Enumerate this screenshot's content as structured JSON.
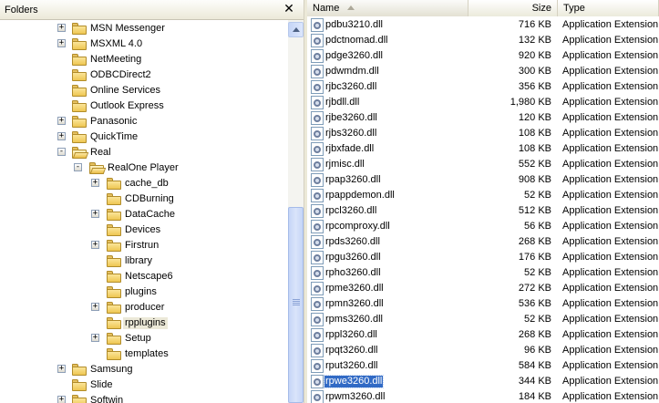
{
  "folders_pane": {
    "title": "Folders",
    "close_glyph": "✕",
    "tree": [
      {
        "label": "MSN Messenger",
        "indent": 1,
        "expander": "+"
      },
      {
        "label": "MSXML 4.0",
        "indent": 1,
        "expander": "+"
      },
      {
        "label": "NetMeeting",
        "indent": 1,
        "expander": ""
      },
      {
        "label": "ODBCDirect2",
        "indent": 1,
        "expander": ""
      },
      {
        "label": "Online Services",
        "indent": 1,
        "expander": ""
      },
      {
        "label": "Outlook Express",
        "indent": 1,
        "expander": ""
      },
      {
        "label": "Panasonic",
        "indent": 1,
        "expander": "+"
      },
      {
        "label": "QuickTime",
        "indent": 1,
        "expander": "+"
      },
      {
        "label": "Real",
        "indent": 1,
        "expander": "-",
        "open": true
      },
      {
        "label": "RealOne Player",
        "indent": 2,
        "expander": "-",
        "open": true
      },
      {
        "label": "cache_db",
        "indent": 3,
        "expander": "+"
      },
      {
        "label": "CDBurning",
        "indent": 3,
        "expander": ""
      },
      {
        "label": "DataCache",
        "indent": 3,
        "expander": "+"
      },
      {
        "label": "Devices",
        "indent": 3,
        "expander": ""
      },
      {
        "label": "Firstrun",
        "indent": 3,
        "expander": "+"
      },
      {
        "label": "library",
        "indent": 3,
        "expander": ""
      },
      {
        "label": "Netscape6",
        "indent": 3,
        "expander": ""
      },
      {
        "label": "plugins",
        "indent": 3,
        "expander": ""
      },
      {
        "label": "producer",
        "indent": 3,
        "expander": "+"
      },
      {
        "label": "rpplugins",
        "indent": 3,
        "expander": "",
        "selected": true
      },
      {
        "label": "Setup",
        "indent": 3,
        "expander": "+"
      },
      {
        "label": "templates",
        "indent": 3,
        "expander": ""
      },
      {
        "label": "Samsung",
        "indent": 1,
        "expander": "+"
      },
      {
        "label": "Slide",
        "indent": 1,
        "expander": ""
      },
      {
        "label": "Softwin",
        "indent": 1,
        "expander": "+"
      }
    ]
  },
  "file_list": {
    "columns": {
      "name": "Name",
      "size": "Size",
      "type": "Type"
    },
    "sort": {
      "column": "Name",
      "direction": "ascending"
    },
    "rows": [
      {
        "name": "pdbu3210.dll",
        "size": "716 KB",
        "type": "Application Extension"
      },
      {
        "name": "pdctnomad.dll",
        "size": "132 KB",
        "type": "Application Extension"
      },
      {
        "name": "pdge3260.dll",
        "size": "920 KB",
        "type": "Application Extension"
      },
      {
        "name": "pdwmdm.dll",
        "size": "300 KB",
        "type": "Application Extension"
      },
      {
        "name": "rjbc3260.dll",
        "size": "356 KB",
        "type": "Application Extension"
      },
      {
        "name": "rjbdll.dll",
        "size": "1,980 KB",
        "type": "Application Extension"
      },
      {
        "name": "rjbe3260.dll",
        "size": "120 KB",
        "type": "Application Extension"
      },
      {
        "name": "rjbs3260.dll",
        "size": "108 KB",
        "type": "Application Extension"
      },
      {
        "name": "rjbxfade.dll",
        "size": "108 KB",
        "type": "Application Extension"
      },
      {
        "name": "rjmisc.dll",
        "size": "552 KB",
        "type": "Application Extension"
      },
      {
        "name": "rpap3260.dll",
        "size": "908 KB",
        "type": "Application Extension"
      },
      {
        "name": "rpappdemon.dll",
        "size": "52 KB",
        "type": "Application Extension"
      },
      {
        "name": "rpcl3260.dll",
        "size": "512 KB",
        "type": "Application Extension"
      },
      {
        "name": "rpcomproxy.dll",
        "size": "56 KB",
        "type": "Application Extension"
      },
      {
        "name": "rpds3260.dll",
        "size": "268 KB",
        "type": "Application Extension"
      },
      {
        "name": "rpgu3260.dll",
        "size": "176 KB",
        "type": "Application Extension"
      },
      {
        "name": "rpho3260.dll",
        "size": "52 KB",
        "type": "Application Extension"
      },
      {
        "name": "rpme3260.dll",
        "size": "272 KB",
        "type": "Application Extension"
      },
      {
        "name": "rpmn3260.dll",
        "size": "536 KB",
        "type": "Application Extension"
      },
      {
        "name": "rpms3260.dll",
        "size": "52 KB",
        "type": "Application Extension"
      },
      {
        "name": "rppl3260.dll",
        "size": "268 KB",
        "type": "Application Extension"
      },
      {
        "name": "rpqt3260.dll",
        "size": "96 KB",
        "type": "Application Extension"
      },
      {
        "name": "rput3260.dll",
        "size": "584 KB",
        "type": "Application Extension"
      },
      {
        "name": "rpwe3260.dll",
        "size": "344 KB",
        "type": "Application Extension",
        "selected": true
      },
      {
        "name": "rpwm3260.dll",
        "size": "184 KB",
        "type": "Application Extension"
      }
    ]
  },
  "icons": {
    "folder": "folder-icon",
    "file": "dll-file-icon",
    "close": "close-icon",
    "expand": "expand-icon",
    "collapse": "collapse-icon"
  },
  "colors": {
    "selection": "#316ac5",
    "header_bg": "#ece9d8",
    "scrollbar": "#c5d5f7"
  }
}
